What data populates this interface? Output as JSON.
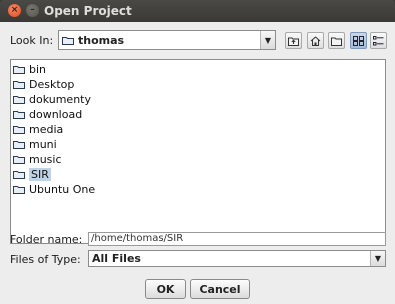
{
  "window": {
    "title": "Open Project"
  },
  "look_in": {
    "label": "Look In:",
    "value": "thomas"
  },
  "toolbar": {
    "buttons": [
      {
        "name": "up-one-level-icon"
      },
      {
        "name": "home-icon"
      },
      {
        "name": "new-folder-icon"
      },
      {
        "name": "list-view-icon",
        "active": true
      },
      {
        "name": "details-view-icon"
      }
    ]
  },
  "files": [
    {
      "name": "bin"
    },
    {
      "name": "Desktop"
    },
    {
      "name": "dokumenty"
    },
    {
      "name": "download"
    },
    {
      "name": "media"
    },
    {
      "name": "muni"
    },
    {
      "name": "music"
    },
    {
      "name": "SIR",
      "selected": true
    },
    {
      "name": "Ubuntu One"
    }
  ],
  "folder_name": {
    "label": "Folder name:",
    "value": "/home/thomas/SIR"
  },
  "files_of_type": {
    "label": "Files of Type:",
    "value": "All Files"
  },
  "actions": {
    "ok": "OK",
    "cancel": "Cancel"
  }
}
